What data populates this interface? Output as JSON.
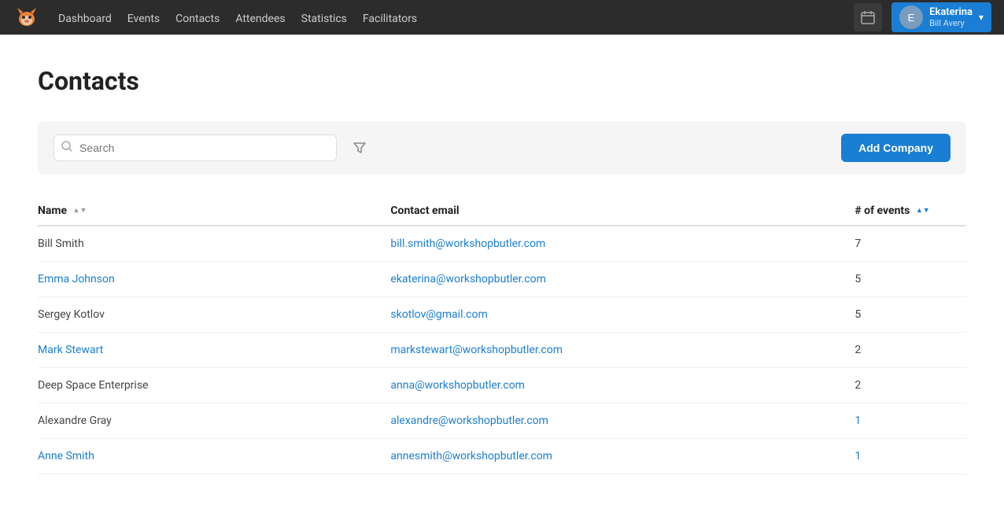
{
  "nav": {
    "logo_alt": "Workshop Butler logo",
    "links": [
      {
        "label": "Dashboard",
        "id": "dashboard"
      },
      {
        "label": "Events",
        "id": "events"
      },
      {
        "label": "Contacts",
        "id": "contacts"
      },
      {
        "label": "Attendees",
        "id": "attendees"
      },
      {
        "label": "Statistics",
        "id": "statistics"
      },
      {
        "label": "Facilitators",
        "id": "facilitators"
      }
    ],
    "user": {
      "name": "Ekaterina",
      "sub": "Bill Avery",
      "initials": "E"
    }
  },
  "page": {
    "title": "Contacts"
  },
  "toolbar": {
    "search_placeholder": "Search",
    "add_button_label": "Add Company"
  },
  "table": {
    "columns": [
      {
        "id": "name",
        "label": "Name",
        "sortable": true,
        "sort_active": false
      },
      {
        "id": "email",
        "label": "Contact email",
        "sortable": false
      },
      {
        "id": "events",
        "label": "# of events",
        "sortable": true,
        "sort_active": true
      }
    ],
    "rows": [
      {
        "name": "Bill Smith",
        "linked": false,
        "email": "bill.smith@workshopbutler.com",
        "events": "7",
        "events_blue": false
      },
      {
        "name": "Emma Johnson",
        "linked": true,
        "email": "ekaterina@workshopbutler.com",
        "events": "5",
        "events_blue": false
      },
      {
        "name": "Sergey Kotlov",
        "linked": false,
        "email": "skotlov@gmail.com",
        "events": "5",
        "events_blue": false
      },
      {
        "name": "Mark Stewart",
        "linked": true,
        "email": "markstewart@workshopbutler.com",
        "events": "2",
        "events_blue": false
      },
      {
        "name": "Deep Space Enterprise",
        "linked": false,
        "email": "anna@workshopbutler.com",
        "events": "2",
        "events_blue": false
      },
      {
        "name": "Alexandre Gray",
        "linked": false,
        "email": "alexandre@workshopbutler.com",
        "events": "1",
        "events_blue": true
      },
      {
        "name": "Anne Smith",
        "linked": true,
        "email": "annesmith@workshopbutler.com",
        "events": "1",
        "events_blue": true
      }
    ]
  }
}
